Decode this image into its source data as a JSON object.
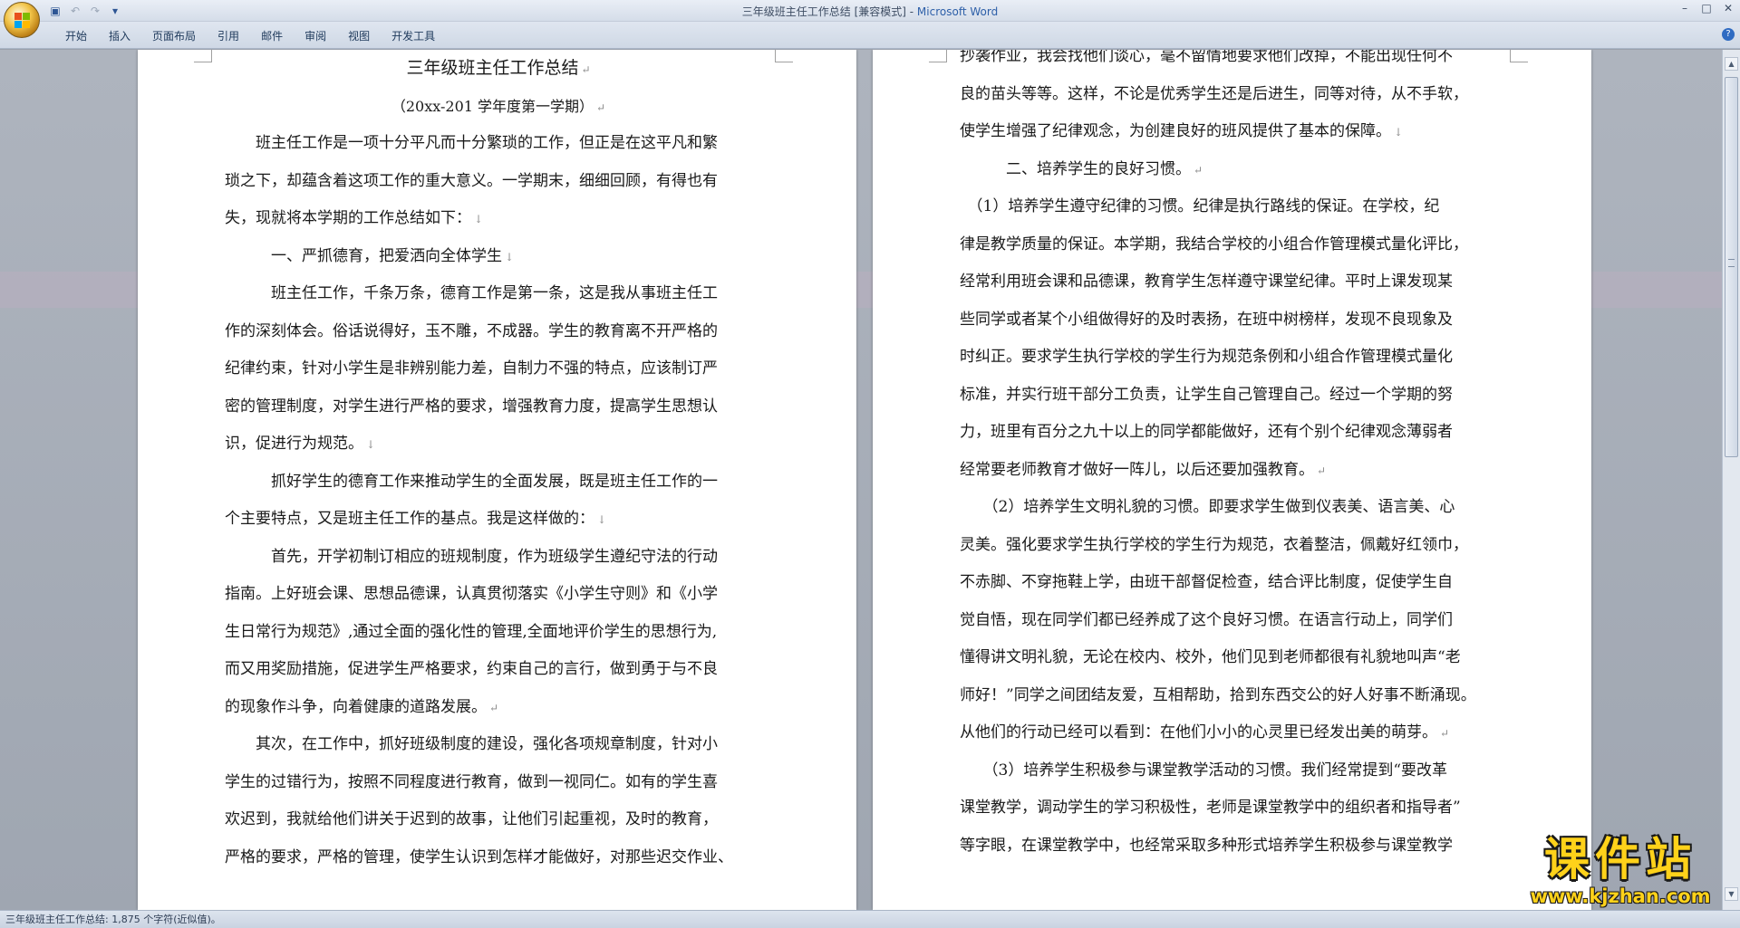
{
  "window": {
    "title_doc": "三年级班主任工作总结 [兼容模式] - ",
    "title_app": "Microsoft Word",
    "controls": {
      "minimize": "–",
      "maximize": "□",
      "close": "✕"
    }
  },
  "quick_access": [
    {
      "icon": "save-icon",
      "glyph": "▣"
    },
    {
      "icon": "undo-icon",
      "glyph": "↶"
    },
    {
      "icon": "redo-icon",
      "glyph": "↷"
    },
    {
      "icon": "customize-icon",
      "glyph": "▾"
    }
  ],
  "ribbon": {
    "tabs": [
      "开始",
      "插入",
      "页面布局",
      "引用",
      "邮件",
      "审阅",
      "视图",
      "开发工具"
    ],
    "help": "?"
  },
  "page1": [
    {
      "text": "三年级班主任工作总结",
      "mark": "↵",
      "cls": "center title"
    },
    {
      "text": "（20xx-201 学年度第一学期）",
      "mark": "↵",
      "cls": "center sub"
    },
    {
      "text": "　　班主任工作是一项十分平凡而十分繁琐的工作，但正是在这平凡和繁",
      "mark": "",
      "cls": ""
    },
    {
      "text": "琐之下，却蕴含着这项工作的重大意义。一学期末，细细回顾，有得也有",
      "mark": "",
      "cls": ""
    },
    {
      "text": "失，现就将本学期的工作总结如下：",
      "mark": "↓",
      "cls": ""
    },
    {
      "text": "　　　一、严抓德育，把爱洒向全体学生",
      "mark": "↓",
      "cls": ""
    },
    {
      "text": "　　　班主任工作，千条万条，德育工作是第一条，这是我从事班主任工",
      "mark": "",
      "cls": ""
    },
    {
      "text": "作的深刻体会。俗话说得好，玉不雕，不成器。学生的教育离不开严格的",
      "mark": "",
      "cls": ""
    },
    {
      "text": "纪律约束，针对小学生是非辨别能力差，自制力不强的特点，应该制订严",
      "mark": "",
      "cls": ""
    },
    {
      "text": "密的管理制度，对学生进行严格的要求，增强教育力度，提高学生思想认",
      "mark": "",
      "cls": ""
    },
    {
      "text": "识，促进行为规范。",
      "mark": "↓",
      "cls": ""
    },
    {
      "text": "　　　抓好学生的德育工作来推动学生的全面发展，既是班主任工作的一",
      "mark": "",
      "cls": ""
    },
    {
      "text": "个主要特点，又是班主任工作的基点。我是这样做的：",
      "mark": "↓",
      "cls": ""
    },
    {
      "text": "　　　首先，开学初制订相应的班规制度，作为班级学生遵纪守法的行动",
      "mark": "",
      "cls": ""
    },
    {
      "text": "指南。上好班会课、思想品德课，认真贯彻落实《小学生守则》和《小学",
      "mark": "",
      "cls": ""
    },
    {
      "text": "生日常行为规范》,通过全面的强化性的管理,全面地评价学生的思想行为,",
      "mark": "",
      "cls": ""
    },
    {
      "text": "而又用奖励措施，促进学生严格要求，约束自己的言行，做到勇于与不良",
      "mark": "",
      "cls": ""
    },
    {
      "text": "的现象作斗争，向着健康的道路发展。",
      "mark": "↵",
      "cls": ""
    },
    {
      "text": "　　其次，在工作中，抓好班级制度的建设，强化各项规章制度，针对小",
      "mark": "",
      "cls": ""
    },
    {
      "text": "学生的过错行为，按照不同程度进行教育，做到一视同仁。如有的学生喜",
      "mark": "",
      "cls": ""
    },
    {
      "text": "欢迟到，我就给他们讲关于迟到的故事，让他们引起重视，及时的教育，",
      "mark": "",
      "cls": ""
    },
    {
      "text": "严格的要求，严格的管理，使学生认识到怎样才能做好，对那些迟交作业、",
      "mark": "",
      "cls": ""
    }
  ],
  "page2": [
    {
      "text": "抄袭作业，我会找他们谈心，毫不留情地要求他们改掉，不能出现任何不",
      "mark": "",
      "cls": ""
    },
    {
      "text": "良的苗头等等。这样，不论是优秀学生还是后进生，同等对待，从不手软，",
      "mark": "",
      "cls": ""
    },
    {
      "text": "使学生增强了纪律观念，为创建良好的班风提供了基本的保障。",
      "mark": "↓",
      "cls": ""
    },
    {
      "text": "　　　二、培养学生的良好习惯。",
      "mark": "↵",
      "cls": ""
    },
    {
      "text": "　（1）培养学生遵守纪律的习惯。纪律是执行路线的保证。在学校，纪",
      "mark": "",
      "cls": ""
    },
    {
      "text": "律是教学质量的保证。本学期，我结合学校的小组合作管理模式量化评比，",
      "mark": "",
      "cls": ""
    },
    {
      "text": "经常利用班会课和品德课，教育学生怎样遵守课堂纪律。平时上课发现某",
      "mark": "",
      "cls": ""
    },
    {
      "text": "些同学或者某个小组做得好的及时表扬，在班中树榜样，发现不良现象及",
      "mark": "",
      "cls": ""
    },
    {
      "text": "时纠正。要求学生执行学校的学生行为规范条例和小组合作管理模式量化",
      "mark": "",
      "cls": ""
    },
    {
      "text": "标准，并实行班干部分工负责，让学生自己管理自己。经过一个学期的努",
      "mark": "",
      "cls": ""
    },
    {
      "text": "力，班里有百分之九十以上的同学都能做好，还有个别个纪律观念薄弱者",
      "mark": "",
      "cls": ""
    },
    {
      "text": "经常要老师教育才做好一阵儿，以后还要加强教育。",
      "mark": "↵",
      "cls": ""
    },
    {
      "text": "　　（2）培养学生文明礼貌的习惯。即要求学生做到仪表美、语言美、心",
      "mark": "",
      "cls": ""
    },
    {
      "text": "灵美。强化要求学生执行学校的学生行为规范，衣着整洁，佩戴好红领巾，",
      "mark": "",
      "cls": ""
    },
    {
      "text": "不赤脚、不穿拖鞋上学，由班干部督促检查，结合评比制度，促使学生自",
      "mark": "",
      "cls": ""
    },
    {
      "text": "觉自悟，现在同学们都已经养成了这个良好习惯。在语言行动上，同学们",
      "mark": "",
      "cls": ""
    },
    {
      "text": "懂得讲文明礼貌，无论在校内、校外，他们见到老师都很有礼貌地叫声“老",
      "mark": "",
      "cls": ""
    },
    {
      "text": "师好！”同学之间团结友爱，互相帮助，拾到东西交公的好人好事不断涌现。",
      "mark": "",
      "cls": ""
    },
    {
      "text": "从他们的行动已经可以看到：在他们小小的心灵里已经发出美的萌芽。",
      "mark": "↵",
      "cls": ""
    },
    {
      "text": "　　（3）培养学生积极参与课堂教学活动的习惯。我们经常提到“要改革",
      "mark": "",
      "cls": ""
    },
    {
      "text": "课堂教学，调动学生的学习积极性，老师是课堂教学中的组织者和指导者”",
      "mark": "",
      "cls": ""
    },
    {
      "text": "等字眼，在课堂教学中，也经常采取多种形式培养学生积极参与课堂教学",
      "mark": "",
      "cls": ""
    }
  ],
  "status": {
    "text": "三年级班主任工作总结: 1,875 个字符(近似值)。"
  },
  "scrollbar": {
    "up": "▲",
    "down": "▼"
  },
  "watermark": {
    "title": "课件站",
    "url": "www.kjzhan.com"
  },
  "colors": {
    "page": "#ffffff",
    "workspace": "#9fa6b1",
    "watermark": "#ffd21a"
  }
}
